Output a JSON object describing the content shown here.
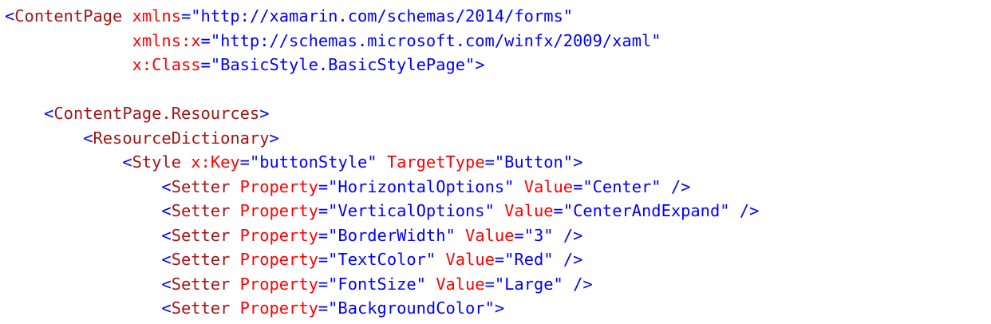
{
  "colors": {
    "delimiter": "#0000ff",
    "element": "#a31515",
    "attribute": "#ff0000",
    "value": "#0000ff",
    "background": "#ffffff"
  },
  "lines": [
    [
      {
        "t": "delim",
        "v": "<"
      },
      {
        "t": "tag",
        "v": "ContentPage"
      },
      {
        "t": "text",
        "v": " "
      },
      {
        "t": "attr",
        "v": "xmlns"
      },
      {
        "t": "delim",
        "v": "="
      },
      {
        "t": "value",
        "v": "\"http://xamarin.com/schemas/2014/forms\""
      }
    ],
    [
      {
        "t": "text",
        "v": "             "
      },
      {
        "t": "attr",
        "v": "xmlns:x"
      },
      {
        "t": "delim",
        "v": "="
      },
      {
        "t": "value",
        "v": "\"http://schemas.microsoft.com/winfx/2009/xaml\""
      }
    ],
    [
      {
        "t": "text",
        "v": "             "
      },
      {
        "t": "attr",
        "v": "x:Class"
      },
      {
        "t": "delim",
        "v": "="
      },
      {
        "t": "value",
        "v": "\"BasicStyle.BasicStylePage\""
      },
      {
        "t": "delim",
        "v": ">"
      }
    ],
    [],
    [
      {
        "t": "text",
        "v": "    "
      },
      {
        "t": "delim",
        "v": "<"
      },
      {
        "t": "tag",
        "v": "ContentPage.Resources"
      },
      {
        "t": "delim",
        "v": ">"
      }
    ],
    [
      {
        "t": "text",
        "v": "        "
      },
      {
        "t": "delim",
        "v": "<"
      },
      {
        "t": "tag",
        "v": "ResourceDictionary"
      },
      {
        "t": "delim",
        "v": ">"
      }
    ],
    [
      {
        "t": "text",
        "v": "            "
      },
      {
        "t": "delim",
        "v": "<"
      },
      {
        "t": "tag",
        "v": "Style"
      },
      {
        "t": "text",
        "v": " "
      },
      {
        "t": "attr",
        "v": "x:Key"
      },
      {
        "t": "delim",
        "v": "="
      },
      {
        "t": "value",
        "v": "\"buttonStyle\""
      },
      {
        "t": "text",
        "v": " "
      },
      {
        "t": "attr",
        "v": "TargetType"
      },
      {
        "t": "delim",
        "v": "="
      },
      {
        "t": "value",
        "v": "\"Button\""
      },
      {
        "t": "delim",
        "v": ">"
      }
    ],
    [
      {
        "t": "text",
        "v": "                "
      },
      {
        "t": "delim",
        "v": "<"
      },
      {
        "t": "tag",
        "v": "Setter"
      },
      {
        "t": "text",
        "v": " "
      },
      {
        "t": "attr",
        "v": "Property"
      },
      {
        "t": "delim",
        "v": "="
      },
      {
        "t": "value",
        "v": "\"HorizontalOptions\""
      },
      {
        "t": "text",
        "v": " "
      },
      {
        "t": "attr",
        "v": "Value"
      },
      {
        "t": "delim",
        "v": "="
      },
      {
        "t": "value",
        "v": "\"Center\""
      },
      {
        "t": "text",
        "v": " "
      },
      {
        "t": "delim",
        "v": "/>"
      }
    ],
    [
      {
        "t": "text",
        "v": "                "
      },
      {
        "t": "delim",
        "v": "<"
      },
      {
        "t": "tag",
        "v": "Setter"
      },
      {
        "t": "text",
        "v": " "
      },
      {
        "t": "attr",
        "v": "Property"
      },
      {
        "t": "delim",
        "v": "="
      },
      {
        "t": "value",
        "v": "\"VerticalOptions\""
      },
      {
        "t": "text",
        "v": " "
      },
      {
        "t": "attr",
        "v": "Value"
      },
      {
        "t": "delim",
        "v": "="
      },
      {
        "t": "value",
        "v": "\"CenterAndExpand\""
      },
      {
        "t": "text",
        "v": " "
      },
      {
        "t": "delim",
        "v": "/>"
      }
    ],
    [
      {
        "t": "text",
        "v": "                "
      },
      {
        "t": "delim",
        "v": "<"
      },
      {
        "t": "tag",
        "v": "Setter"
      },
      {
        "t": "text",
        "v": " "
      },
      {
        "t": "attr",
        "v": "Property"
      },
      {
        "t": "delim",
        "v": "="
      },
      {
        "t": "value",
        "v": "\"BorderWidth\""
      },
      {
        "t": "text",
        "v": " "
      },
      {
        "t": "attr",
        "v": "Value"
      },
      {
        "t": "delim",
        "v": "="
      },
      {
        "t": "value",
        "v": "\"3\""
      },
      {
        "t": "text",
        "v": " "
      },
      {
        "t": "delim",
        "v": "/>"
      }
    ],
    [
      {
        "t": "text",
        "v": "                "
      },
      {
        "t": "delim",
        "v": "<"
      },
      {
        "t": "tag",
        "v": "Setter"
      },
      {
        "t": "text",
        "v": " "
      },
      {
        "t": "attr",
        "v": "Property"
      },
      {
        "t": "delim",
        "v": "="
      },
      {
        "t": "value",
        "v": "\"TextColor\""
      },
      {
        "t": "text",
        "v": " "
      },
      {
        "t": "attr",
        "v": "Value"
      },
      {
        "t": "delim",
        "v": "="
      },
      {
        "t": "value",
        "v": "\"Red\""
      },
      {
        "t": "text",
        "v": " "
      },
      {
        "t": "delim",
        "v": "/>"
      }
    ],
    [
      {
        "t": "text",
        "v": "                "
      },
      {
        "t": "delim",
        "v": "<"
      },
      {
        "t": "tag",
        "v": "Setter"
      },
      {
        "t": "text",
        "v": " "
      },
      {
        "t": "attr",
        "v": "Property"
      },
      {
        "t": "delim",
        "v": "="
      },
      {
        "t": "value",
        "v": "\"FontSize\""
      },
      {
        "t": "text",
        "v": " "
      },
      {
        "t": "attr",
        "v": "Value"
      },
      {
        "t": "delim",
        "v": "="
      },
      {
        "t": "value",
        "v": "\"Large\""
      },
      {
        "t": "text",
        "v": " "
      },
      {
        "t": "delim",
        "v": "/>"
      }
    ],
    [
      {
        "t": "text",
        "v": "                "
      },
      {
        "t": "delim",
        "v": "<"
      },
      {
        "t": "tag",
        "v": "Setter"
      },
      {
        "t": "text",
        "v": " "
      },
      {
        "t": "attr",
        "v": "Property"
      },
      {
        "t": "delim",
        "v": "="
      },
      {
        "t": "value",
        "v": "\"BackgroundColor\""
      },
      {
        "t": "delim",
        "v": ">"
      }
    ]
  ]
}
